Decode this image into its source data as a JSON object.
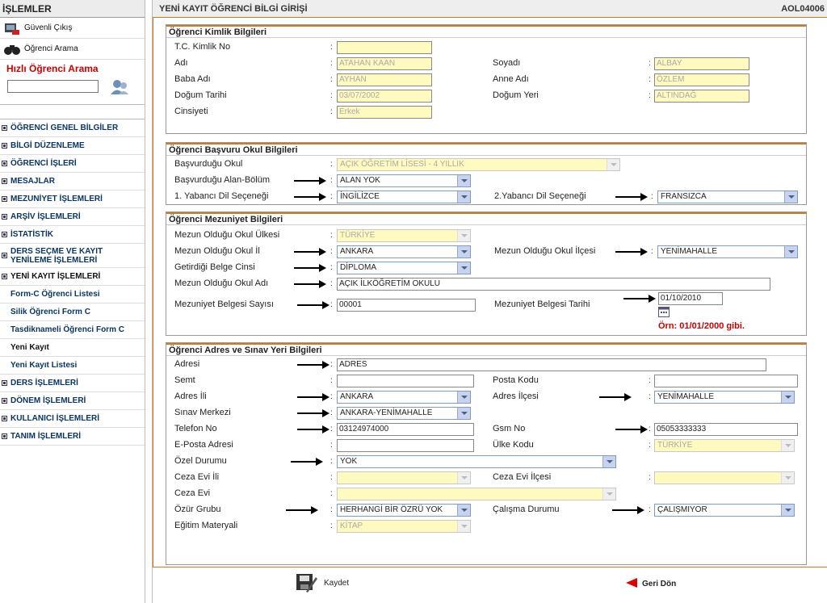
{
  "sidebar": {
    "header": "İŞLEMLER",
    "logout": "Güvenli Çıkış",
    "search": "Öğrenci Arama",
    "quick_search": "Hızlı Öğrenci Arama",
    "menu": [
      "ÖĞRENCİ GENEL BİLGİLER",
      "BİLGİ DÜZENLEME",
      "ÖĞRENCİ İŞLERİ",
      "MESAJLAR",
      "MEZUNİYET İŞLEMLERİ",
      "ARŞİV İŞLEMLERİ",
      "İSTATİSTİK",
      "DERS SEÇME VE KAYIT YENİLEME İŞLEMLERİ",
      "YENİ KAYIT İŞLEMLERİ"
    ],
    "sub": [
      "Form-C Öğrenci Listesi",
      "Silik Öğrenci Form C",
      "Tasdiknameli Öğrenci Form C",
      "Yeni Kayıt",
      "Yeni Kayıt Listesi"
    ],
    "menu2": [
      "DERS İŞLEMLERİ",
      "DÖNEM İŞLEMLERİ",
      "KULLANICI İŞLEMLERİ",
      "TANIM İŞLEMLERİ"
    ]
  },
  "header": {
    "title": "YENİ KAYIT ÖĞRENCİ BİLGİ GİRİŞİ",
    "code": "AOL04006"
  },
  "identity": {
    "title": "Öğrenci Kimlik Bilgileri",
    "tc_label": "T.C. Kimlik No",
    "name_label": "Adı",
    "name": "ATAHAN KAAN",
    "surname_label": "Soyadı",
    "surname": "ALBAY",
    "father_label": "Baba Adı",
    "father": "AYHAN",
    "mother_label": "Anne Adı",
    "mother": "ÖZLEM",
    "birthdate_label": "Doğum Tarihi",
    "birthdate": "03/07/2002",
    "birthplace_label": "Doğum Yeri",
    "birthplace": "ALTINDAĞ",
    "gender_label": "Cinsiyeti",
    "gender": "Erkek"
  },
  "school": {
    "title": "Öğrenci  Başvuru Okul Bilgileri",
    "school_label": "Başvurduğu Okul",
    "school": "AÇIK ÖĞRETİM LİSESİ - 4 YILLIK",
    "area_label": "Başvurduğu Alan-Bölüm",
    "area": "ALAN YOK",
    "lang1_label": "1. Yabancı Dil Seçeneği",
    "lang1": "İNGİLİZCE",
    "lang2_label": "2.Yabancı Dil Seçeneği",
    "lang2": "FRANSIZCA"
  },
  "grad": {
    "title": "Öğrenci Mezuniyet Bilgileri",
    "country_label": "Mezun Olduğu Okul Ülkesi",
    "country": "TÜRKİYE",
    "province_label": "Mezun Olduğu Okul İl",
    "province": "ANKARA",
    "district_label": "Mezun Olduğu Okul İlçesi",
    "district": "YENİMAHALLE",
    "doc_label": "Getirdiği Belge Cinsi",
    "doc": "DİPLOMA",
    "schoolname_label": "Mezun Olduğu Okul Adı",
    "schoolname": "AÇIK İLKÖĞRETİM OKULU",
    "certno_label": "Mezuniyet Belgesi Sayısı",
    "certno": "00001",
    "certdate_label": "Mezuniyet Belgesi Tarihi",
    "certdate": "01/10/2010",
    "example": "Örn: 01/01/2000 gibi."
  },
  "address": {
    "title": "Öğrenci Adres ve Sınav Yeri Bilgileri",
    "address_label": "Adresi",
    "address": "ADRES",
    "semt_label": "Semt",
    "postal_label": "Posta Kodu",
    "prov_label": "Adres İli",
    "prov": "ANKARA",
    "dist_label": "Adres İlçesi",
    "dist": "YENİMAHALLE",
    "exam_label": "Sınav Merkezi",
    "exam": "ANKARA-YENİMAHALLE",
    "phone_label": "Telefon No",
    "phone": "03124974000",
    "gsm_label": "Gsm No",
    "gsm": "05053333333",
    "email_label": "E-Posta Adresi",
    "country_code_label": "Ülke Kodu",
    "country_code": "TÜRKİYE",
    "special_label": "Özel Durumu",
    "special": "YOK",
    "prison_prov_label": "Ceza Evi İli",
    "prison_dist_label": "Ceza Evi İlçesi",
    "prison_label": "Ceza Evi",
    "disability_label": "Özür Grubu",
    "disability": "HERHANGİ BİR ÖZRÜ YOK",
    "work_label": "Çalışma Durumu",
    "work": "ÇALIŞMIYOR",
    "material_label": "Eğitim Materyali",
    "material": "KİTAP"
  },
  "footer": {
    "save": "Kaydet",
    "back": "Geri Dön"
  }
}
